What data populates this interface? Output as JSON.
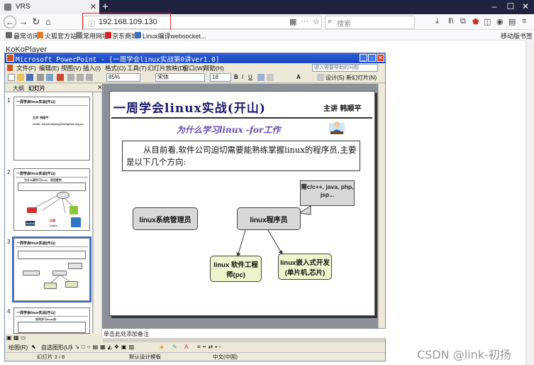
{
  "browser": {
    "tab_title": "VRS",
    "new_tab_label": "+",
    "url": "192.168.109.130",
    "search_placeholder": "搜索",
    "bookmarks": [
      "最常访问",
      "火狐官方站点",
      "常用网址",
      "京东商城",
      "Linux编译websocket..."
    ],
    "mobile_bookmarks": "移动版书签"
  },
  "page": {
    "title": "KoKoPlayer"
  },
  "ppt": {
    "window_title": "Microsoft PowerPoint - [一周学会linux实战第0讲ver1.0]",
    "menus": [
      "文件(F)",
      "编辑(E)",
      "视图(V)",
      "插入(I)",
      "格式(O)",
      "工具(T)",
      "幻灯片放映(D)",
      "窗口(W)",
      "帮助(H)"
    ],
    "help_placeholder": "键入需要帮助的问题",
    "zoom": "85%",
    "font": "宋体",
    "font_size": "18",
    "design_label": "设计(S)",
    "new_slide_label": "新幻灯片(N)",
    "panel_tabs": [
      "大纲",
      "幻灯片"
    ],
    "notes_placeholder": "单击此处添加备注",
    "status": {
      "slide": "幻灯片 3 / 8",
      "template": "默认设计模板",
      "language": "中文(中国)"
    },
    "draw_label": "绘图(R)",
    "autoshape_label": "自选图形(U)"
  },
  "thumbnails": [
    {
      "num": "1",
      "title": "一周学会linux实战(开山)",
      "lines": [
        "主讲: 韩顺平",
        "email: hanshunping@tsinghua.org.cn"
      ]
    },
    {
      "num": "2",
      "title": "一周学会linux实战(开山)",
      "subtitle": "为什么要学习linux  - 我是看完",
      "brands": [
        "fedora",
        "红帽",
        "Linux"
      ]
    },
    {
      "num": "3",
      "title": "一周学会linux实战(开山)"
    },
    {
      "num": "4",
      "title": "一周学会linux实战(开山)",
      "subtitle": "如何学习linux好"
    }
  ],
  "slide": {
    "title": "一周学会linux实战(开山)",
    "author": "主讲 韩顺平",
    "subtitle": "为什么学习linux   -for工作",
    "paragraph": "从目前看,软件公司迫切需要能熟练掌握linux的程序员,主要是以下几个方向:",
    "nodes": {
      "admin": "linux系统管理员",
      "programmer": "linux程序员",
      "pc": "linux 软件工程师(pc)",
      "embedded": "linux嵌入式开发(单片机,芯片)",
      "callout": "需c/c++, java, php, jsp..."
    }
  },
  "watermark": "CSDN @link-初扬"
}
